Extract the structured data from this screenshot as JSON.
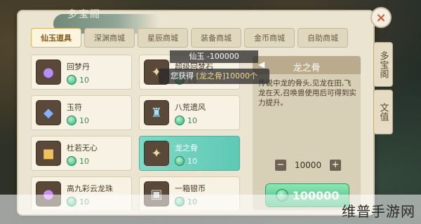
{
  "window": {
    "title": "多宝阁"
  },
  "tabs": [
    {
      "label": "仙玉道具",
      "active": true
    },
    {
      "label": "深渊商城",
      "active": false
    },
    {
      "label": "星辰商城",
      "active": false
    },
    {
      "label": "装备商城",
      "active": false
    },
    {
      "label": "金币商城",
      "active": false
    },
    {
      "label": "自助商城",
      "active": false
    }
  ],
  "items": [
    {
      "name": "回梦丹",
      "price": "10",
      "icon": "purple-pill-icon"
    },
    {
      "name": "超级回梦石",
      "price": "10",
      "icon": "dragon-bone-icon"
    },
    {
      "name": "玉符",
      "price": "10",
      "icon": "blue-talisman-icon"
    },
    {
      "name": "八荒遗风",
      "price": "10",
      "icon": "jar-icon"
    },
    {
      "name": "杜若无心",
      "price": "10",
      "icon": "treasure-chest-icon"
    },
    {
      "name": "龙之骨",
      "price": "10",
      "icon": "dragon-bone-icon",
      "selected": true
    },
    {
      "name": "高九彩云龙珠",
      "price": "10",
      "icon": "purple-pearl-icon"
    },
    {
      "name": "一箱银币",
      "price": "10",
      "icon": "silver-chest-icon"
    }
  ],
  "detail": {
    "title": "龙之骨",
    "description": "传说中龙的骨头,见龙在田,飞龙在天,召唤兽使用后可得到实力提升。",
    "quantity": "10000",
    "minus": "−",
    "plus": "+",
    "buy_label": "100000"
  },
  "side_tabs": [
    "多宝阁",
    "文值"
  ],
  "toast": {
    "line1": "仙玉 -100000",
    "line2_prefix": "您获得",
    "line2_item": "[龙之骨]10000个"
  },
  "close_label": "×",
  "watermark": "维普手游网",
  "colors": {
    "accent": "#5ec9b5",
    "jade": "#2fae72",
    "panel": "#ebe4d0"
  }
}
